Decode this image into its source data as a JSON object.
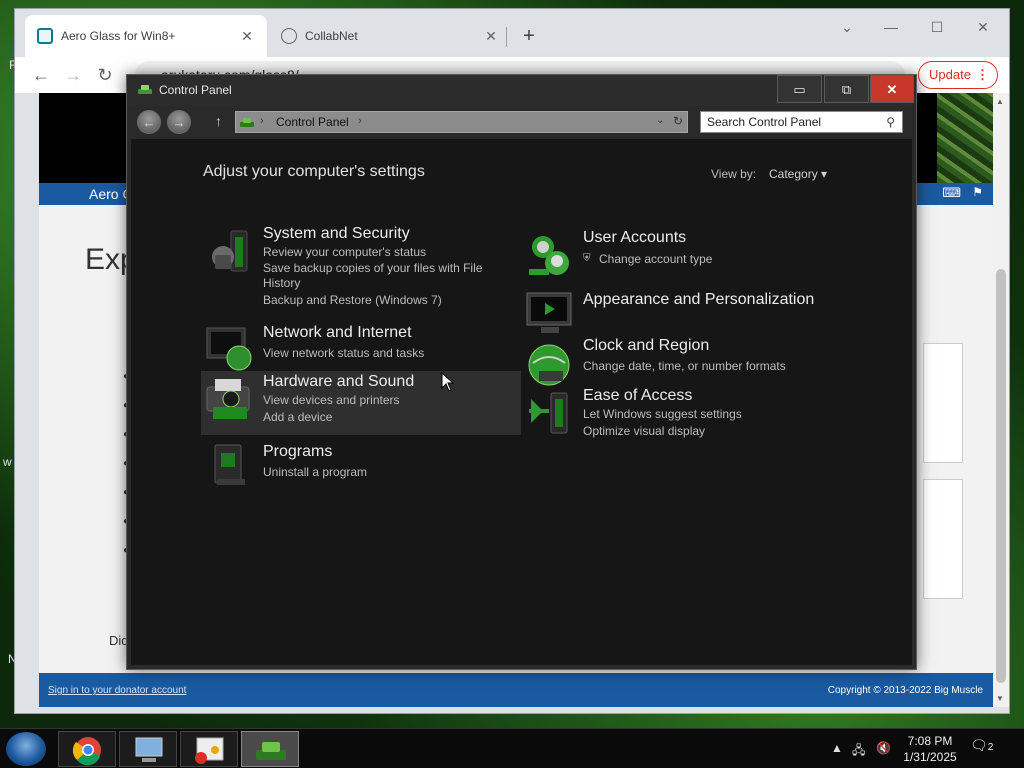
{
  "browser": {
    "tabs": [
      {
        "title": "Aero Glass for Win8+",
        "favicon": "aero-glass-favicon"
      },
      {
        "title": "CollabNet",
        "favicon": "globe-icon"
      }
    ],
    "new_tab": "+",
    "url": "arukateru.com/glass8/",
    "update_label": "Update",
    "window_controls": {
      "collapse": "⌄",
      "minimize": "—",
      "maximize": "☐",
      "close": "✕"
    }
  },
  "page": {
    "nav_text": "Aero G",
    "heading": "Exp",
    "did_text": "Did",
    "footer_signin": "Sign in to your donator account",
    "footer_copyright": "Copyright © 2013-2022 Big Muscle"
  },
  "control_panel": {
    "title": "Control Panel",
    "breadcrumb": "Control Panel",
    "search_placeholder": "Search Control Panel",
    "heading": "Adjust your computer's settings",
    "view_by_label": "View by:",
    "view_by_value": "Category",
    "left_categories": [
      {
        "title": "System and Security",
        "icon": "shield-icon",
        "links": [
          "Review your computer's status",
          "Save backup copies of your files with File History",
          "Backup and Restore (Windows 7)"
        ]
      },
      {
        "title": "Network and Internet",
        "icon": "network-globe-icon",
        "links": [
          "View network status and tasks"
        ]
      },
      {
        "title": "Hardware and Sound",
        "icon": "printer-icon",
        "links": [
          "View devices and printers",
          "Add a device"
        ]
      },
      {
        "title": "Programs",
        "icon": "programs-icon",
        "links": [
          "Uninstall a program"
        ]
      }
    ],
    "right_categories": [
      {
        "title": "User Accounts",
        "icon": "users-icon",
        "links": [
          "Change account type"
        ]
      },
      {
        "title": "Appearance and Personalization",
        "icon": "monitor-icon",
        "links": []
      },
      {
        "title": "Clock and Region",
        "icon": "clock-globe-icon",
        "links": [
          "Change date, time, or number formats"
        ]
      },
      {
        "title": "Ease of Access",
        "icon": "accessibility-icon",
        "links": [
          "Let Windows suggest settings",
          "Optimize visual display"
        ]
      }
    ]
  },
  "taskbar": {
    "time": "7:08 PM",
    "date": "1/31/2025",
    "notification_count": "2"
  }
}
